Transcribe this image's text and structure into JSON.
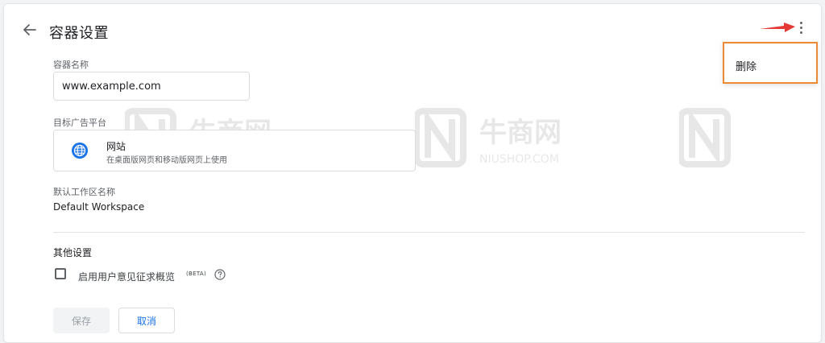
{
  "header": {
    "title": "容器设置",
    "back_icon": "arrow-left-icon",
    "more_icon": "more-vert-icon"
  },
  "menu": {
    "items": [
      {
        "label": "删除"
      }
    ],
    "highlight_color": "#ee8a33"
  },
  "annotation": {
    "arrow_color": "#e53935"
  },
  "form": {
    "container_name_label": "容器名称",
    "container_name_value": "www.example.com",
    "target_platform_label": "目标广告平台",
    "platform": {
      "icon": "globe-icon",
      "name": "网站",
      "description": "在桌面版网页和移动版网页上使用",
      "icon_color": "#1a73e8"
    },
    "workspace_label": "默认工作区名称",
    "workspace_value": "Default Workspace",
    "other_settings_title": "其他设置",
    "option": {
      "label": "启用用户意见征求概览",
      "badge": "(BETA)",
      "checked": false,
      "help_icon": "help-circle-icon"
    }
  },
  "actions": {
    "save_label": "保存",
    "cancel_label": "取消",
    "primary_color": "#1a73e8"
  },
  "watermark": {
    "brand": "牛商网",
    "domain": "NIUSHOP.COM"
  }
}
